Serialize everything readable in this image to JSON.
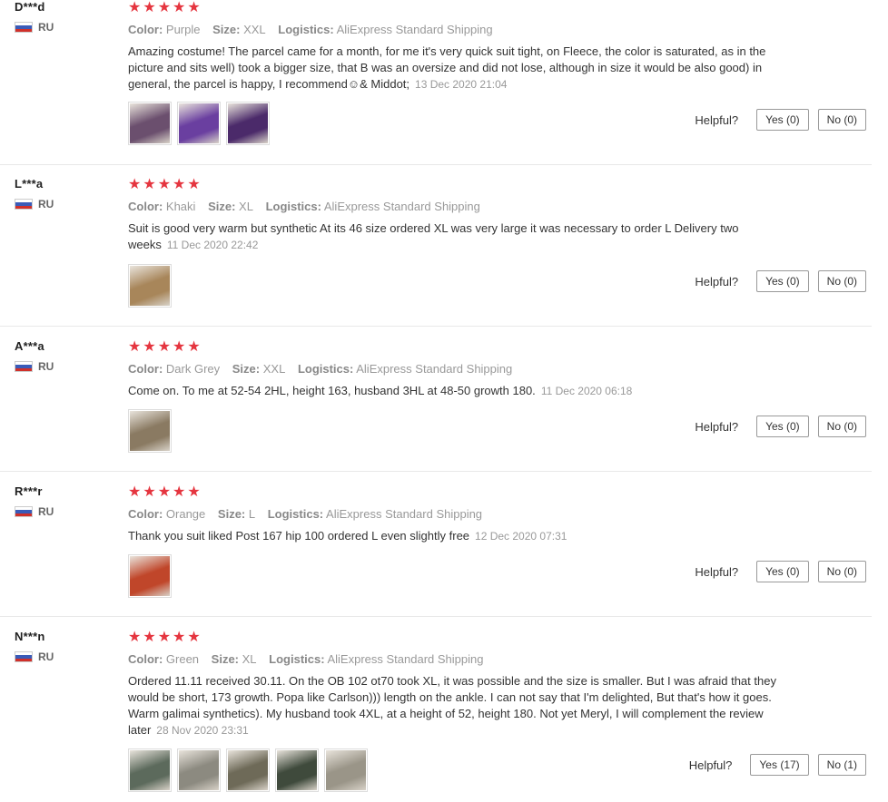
{
  "labels": {
    "color": "Color:",
    "size": "Size:",
    "logistics": "Logistics:",
    "helpful": "Helpful?"
  },
  "star_color": "#e5353f",
  "reviews": [
    {
      "user": "D***d",
      "country": "RU",
      "stars": "★★★★★",
      "rating": 5,
      "color": "Purple",
      "size": "XXL",
      "logistics": "AliExpress Standard Shipping",
      "text": "Amazing costume! The parcel came for a month, for me it's very quick suit tight, on Fleece, the color is saturated, as in the picture and sits well) took a bigger size, that B was an oversize and did not lose, although in size it would be also good) in general, the parcel is happy, I recommend☺& Middot;",
      "date": "13 Dec 2020 21:04",
      "yes": "Yes (0)",
      "no": "No (0)",
      "photos": [
        "#6b4f6e",
        "#6a3fa0",
        "#4b2a6a"
      ]
    },
    {
      "user": "L***a",
      "country": "RU",
      "stars": "★★★★★",
      "rating": 5,
      "color": "Khaki",
      "size": "XL",
      "logistics": "AliExpress Standard Shipping",
      "text": "Suit is good very warm but synthetic At its 46 size ordered XL was very large it was necessary to order L Delivery two weeks",
      "date": "11 Dec 2020 22:42",
      "yes": "Yes (0)",
      "no": "No (0)",
      "photos": [
        "#a8865a"
      ]
    },
    {
      "user": "A***a",
      "country": "RU",
      "stars": "★★★★★",
      "rating": 5,
      "color": "Dark Grey",
      "size": "XXL",
      "logistics": "AliExpress Standard Shipping",
      "text": "Come on. To me at 52-54 2HL, height 163, husband 3HL at 48-50 growth 180.",
      "date": "11 Dec 2020 06:18",
      "yes": "Yes (0)",
      "no": "No (0)",
      "photos": [
        "#8a7a62"
      ]
    },
    {
      "user": "R***r",
      "country": "RU",
      "stars": "★★★★★",
      "rating": 5,
      "color": "Orange",
      "size": "L",
      "logistics": "AliExpress Standard Shipping",
      "text": "Thank you suit liked Post 167 hip 100 ordered L even slightly free",
      "date": "12 Dec 2020 07:31",
      "yes": "Yes (0)",
      "no": "No (0)",
      "photos": [
        "#c0462a"
      ]
    },
    {
      "user": "N***n",
      "country": "RU",
      "stars": "★★★★★",
      "rating": 5,
      "color": "Green",
      "size": "XL",
      "logistics": "AliExpress Standard Shipping",
      "text": "Ordered 11.11 received 30.11. On the OB 102 ot70 took XL, it was possible and the size is smaller. But I was afraid that they would be short, 173 growth. Popa like Carlson))) length on the ankle. I can not say that I'm delighted, But that's how it goes. Warm galimai synthetics). My husband took 4XL, at a height of 52, height 180. Not yet Meryl, I will complement the review later",
      "date": "28 Nov 2020 23:31",
      "yes": "Yes (17)",
      "no": "No (1)",
      "photos": [
        "#5c6a5c",
        "#8c8a80",
        "#6e6a58",
        "#3f4a3c",
        "#9a9588"
      ]
    }
  ]
}
